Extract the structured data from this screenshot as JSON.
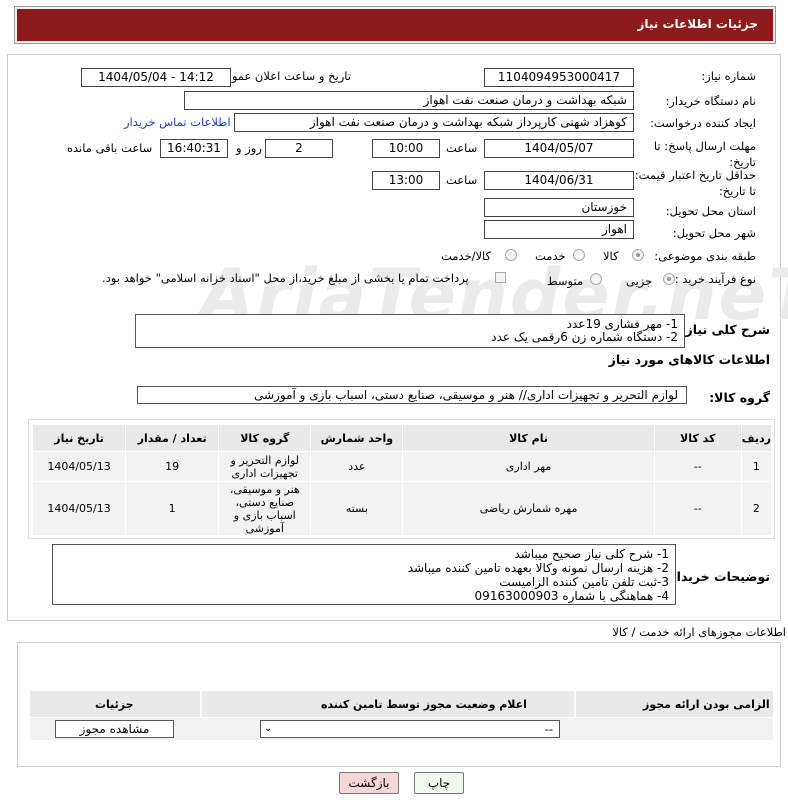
{
  "header": {
    "title": "جزئیات اطلاعات نیاز"
  },
  "watermark": "AriaTender.neT",
  "labels": {
    "need_number": "شماره نیاز:",
    "announce_datetime": "تاریخ و ساعت اعلان عمومی:",
    "buyer_org": "نام دستگاه خریدار:",
    "creator": "ایجاد کننده درخواست:",
    "buyer_contact_link": "اطلاعات تماس خریدار",
    "reply_deadline": "مهلت ارسال پاسخ: تا تاریخ:",
    "time": "ساعت",
    "days_and": "روز و",
    "hours_remaining": "ساعت باقی مانده",
    "price_validity": "حداقل تاریخ اعتبار قیمت: تا تاریخ:",
    "delivery_province": "استان محل تحویل:",
    "delivery_city": "شهر محل تحویل:",
    "subject_category": "طبقه بندی موضوعی:",
    "purchase_process": "نوع فرآیند خرید :",
    "need_description": "شرح کلی نیاز:",
    "goods_info": "اطلاعات کالاهای مورد نیاز",
    "goods_group": "گروه کالا:",
    "buyer_notes": "توضیحات خریدار:",
    "permits_title": "اطلاعات مجوزهای ارائه خدمت / کالا"
  },
  "fields": {
    "need_number": "1104094953000417",
    "announce_datetime": "1404/05/04 - 14:12",
    "buyer_org": "شبکه بهداشت و درمان صنعت نفت اهواز",
    "creator": "کوهزاد شهنی کارپرداز شبکه بهداشت و درمان صنعت نفت اهواز",
    "reply_date": "1404/05/07",
    "reply_time": "10:00",
    "reply_days": "2",
    "reply_remaining": "16:40:31",
    "validity_date": "1404/06/31",
    "validity_time": "13:00",
    "province": "خوزستان",
    "city": "اهواز"
  },
  "subject_options": [
    {
      "label": "کالا",
      "selected": true
    },
    {
      "label": "خدمت",
      "selected": false
    },
    {
      "label": "کالا/خدمت",
      "selected": false
    }
  ],
  "process_options": [
    {
      "label": "جزیی",
      "selected": true
    },
    {
      "label": "متوسط",
      "selected": false
    }
  ],
  "payment_note": "پرداخت تمام یا بخشی از مبلغ خرید،از محل \"اسناد خزانه اسلامی\" خواهد بود.",
  "need_description": "1- مهر فشاری 19عدد\n2- دستگاه شماره زن 6رقمی یک عدد",
  "goods_group_value": "لوازم التحریر و تجهیزات اداری// هنر و موسیقی، صنایع دستی، اسباب بازی و آموزشی",
  "items_table": {
    "headers": [
      "ردیف",
      "کد کالا",
      "نام کالا",
      "واحد شمارش",
      "گروه کالا",
      "تعداد / مقدار",
      "تاریخ نیاز"
    ],
    "rows": [
      [
        "1",
        "--",
        "مهر اداری",
        "عدد",
        "لوازم التحریر و تجهیزات اداری",
        "19",
        "1404/05/13"
      ],
      [
        "2",
        "--",
        "مهره شمارش ریاضی",
        "بسته",
        "هنر و موسیقی، صنایع دستی، اسباب بازی و آموزشی",
        "1",
        "1404/05/13"
      ]
    ]
  },
  "buyer_notes": "1- شرح کلی نیاز صحیح میباشد\n2- هزینه ارسال نمونه وکالا بعهده تامین کننده میباشد\n3-ثبت تلفن تامین کننده الزامیست\n4- هماهنگی با شماره 09163000903",
  "permits_table": {
    "headers": [
      "الزامی بودن ارائه مجوز",
      "اعلام وضعیت مجوز توسط تامین کننده",
      "جزئیات"
    ],
    "select_value": "--",
    "view_button": "مشاهده مجوز"
  },
  "buttons": {
    "print": "چاپ",
    "back": "بازگشت"
  },
  "colors": {
    "header_bg": "#8e1b1b",
    "link": "#1a3ec9",
    "table_header": "#e9e9e9",
    "table_cell": "#f2f2f2",
    "back_button": "#f7d6d6"
  }
}
